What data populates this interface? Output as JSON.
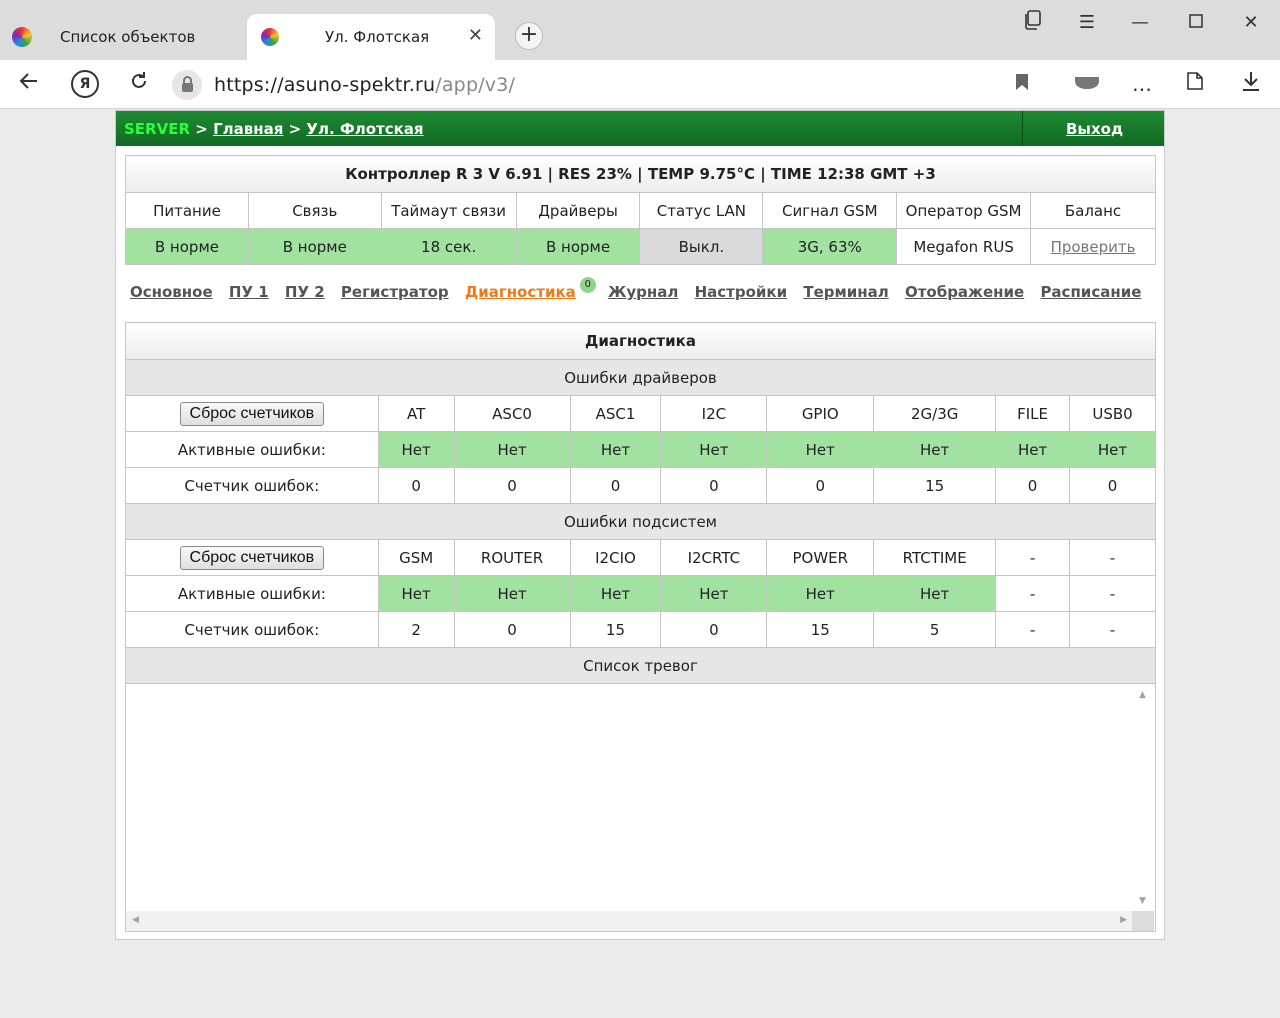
{
  "browser": {
    "tabs": [
      {
        "label": "Список объектов"
      },
      {
        "label": "Ул. Флотская"
      }
    ],
    "url_host": "https://asuno-spektr.ru",
    "url_path": "/app/v3/"
  },
  "header": {
    "server": "SERVER",
    "sep": ">",
    "home": "Главная",
    "current": "Ул. Флотская",
    "logout": "Выход"
  },
  "status": {
    "title": "Контроллер R 3 V 6.91 | RES 23% | TEMP 9.75°C | TIME 12:38 GMT +3",
    "columns": [
      "Питание",
      "Связь",
      "Таймаут связи",
      "Драйверы",
      "Статус LAN",
      "Сигнал GSM",
      "Оператор GSM",
      "Баланс"
    ],
    "values": [
      "В норме",
      "В норме",
      "18 сек.",
      "В норме",
      "Выкл.",
      "3G, 63%",
      "Megafon RUS",
      "Проверить"
    ]
  },
  "nav": {
    "items": [
      "Основное",
      "ПУ 1",
      "ПУ 2",
      "Регистратор",
      "Диагностика",
      "Журнал",
      "Настройки",
      "Терминал",
      "Отображение",
      "Расписание"
    ],
    "badge": "0"
  },
  "diag": {
    "title": "Диагностика",
    "reset_label": "Сброс счетчиков",
    "active_label": "Активные ошибки:",
    "counter_label": "Счетчик ошибок:",
    "drivers": {
      "title": "Ошибки драйверов",
      "columns": [
        "AT",
        "ASC0",
        "ASC1",
        "I2C",
        "GPIO",
        "2G/3G",
        "FILE",
        "USB0"
      ],
      "active": [
        "Нет",
        "Нет",
        "Нет",
        "Нет",
        "Нет",
        "Нет",
        "Нет",
        "Нет"
      ],
      "counters": [
        "0",
        "0",
        "0",
        "0",
        "0",
        "15",
        "0",
        "0"
      ]
    },
    "subsystems": {
      "title": "Ошибки подсистем",
      "columns": [
        "GSM",
        "ROUTER",
        "I2CIO",
        "I2CRTC",
        "POWER",
        "RTCTIME",
        "-",
        "-"
      ],
      "active": [
        "Нет",
        "Нет",
        "Нет",
        "Нет",
        "Нет",
        "Нет",
        "-",
        "-"
      ],
      "counters": [
        "2",
        "0",
        "15",
        "0",
        "15",
        "5",
        "-",
        "-"
      ]
    },
    "alarms_title": "Список тревог"
  },
  "colors": {
    "ok": "#a1e2a1",
    "off": "#dadada",
    "topbar": "#15782a",
    "active_tab": "#ee7a18"
  }
}
